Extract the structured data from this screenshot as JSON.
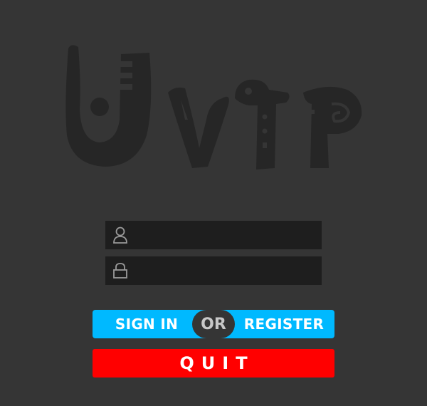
{
  "logo": {
    "text": "UVTP",
    "color": "#262626"
  },
  "login": {
    "username_icon": "user-icon",
    "username_value": "",
    "password_icon": "lock-icon",
    "password_value": ""
  },
  "actions": {
    "signin_label": "SIGN IN",
    "or_label": "OR",
    "register_label": "REGISTER",
    "quit_label": "QUIT"
  },
  "colors": {
    "background": "#353535",
    "field": "#1e1e1e",
    "primary": "#00b9ff",
    "danger": "#ff0000",
    "or_text": "#c8c8c8"
  }
}
